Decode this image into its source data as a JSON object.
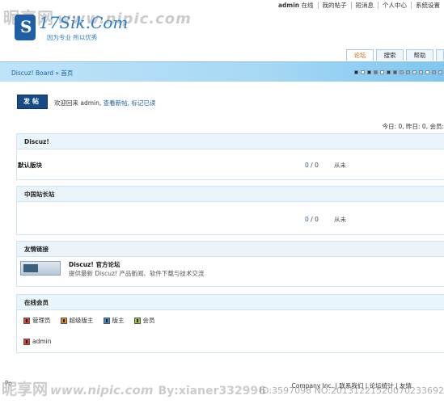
{
  "watermark": {
    "site": "昵享网",
    "url": "www.nipic.com",
    "by": "By:xianer332996",
    "id": "ID:3597098 NO:20131221520070233692"
  },
  "toplinks": [
    "admin",
    "在线",
    "我的帖子",
    "短消息",
    "个人中心",
    "系统设置"
  ],
  "logo": {
    "name": "17Sik.Com",
    "slogan": "因为专业 所以优秀"
  },
  "nav": {
    "tabs": [
      "论坛",
      "搜索",
      "帮助"
    ]
  },
  "breadcrumb": "Discuz! Board » 首页",
  "swatch_colors": [
    "#1a2a3a",
    "#ffffff",
    "#2b2b2b",
    "#6a7a8a",
    "#ffffff",
    "#3a3a3a",
    "#5a5a5a",
    "#aab",
    "#9ac",
    "#dde",
    "#cce",
    "#fff",
    "#9ab",
    "#ccd"
  ],
  "post_button": "发帖",
  "welcome": {
    "prefix": "欢迎回来",
    "user": "admin,",
    "new_posts": "查看新帖,",
    "mark_read": "标记已读"
  },
  "stats": "今日: 0, 昨日: 0, 会员:",
  "forums": [
    {
      "category": "Discuz!",
      "name": "默认版块",
      "topics": "0",
      "posts": "0",
      "last": "从未"
    },
    {
      "category": "中国站长站",
      "name": "",
      "topics": "0",
      "posts": "0",
      "last": "从未"
    }
  ],
  "links": {
    "title": "友情链接",
    "site_title": "Discuz! 官方论坛",
    "site_desc": "提供最新 Discuz! 产品新闻、软件下载与技术交流"
  },
  "online": {
    "title": "在线会员",
    "legend": [
      {
        "label": "管理员",
        "color": "#d9442b"
      },
      {
        "label": "超级版主",
        "color": "#e58a1a"
      },
      {
        "label": "版主",
        "color": "#3b8fd0"
      },
      {
        "label": "会员",
        "color": "#9bcc2a"
      }
    ],
    "users": [
      {
        "name": "admin",
        "color": "#d9442b"
      }
    ]
  },
  "footer": {
    "left": "Po",
    "right": "Company Inc. | 联系我们 | 论坛统计 | 友情"
  }
}
